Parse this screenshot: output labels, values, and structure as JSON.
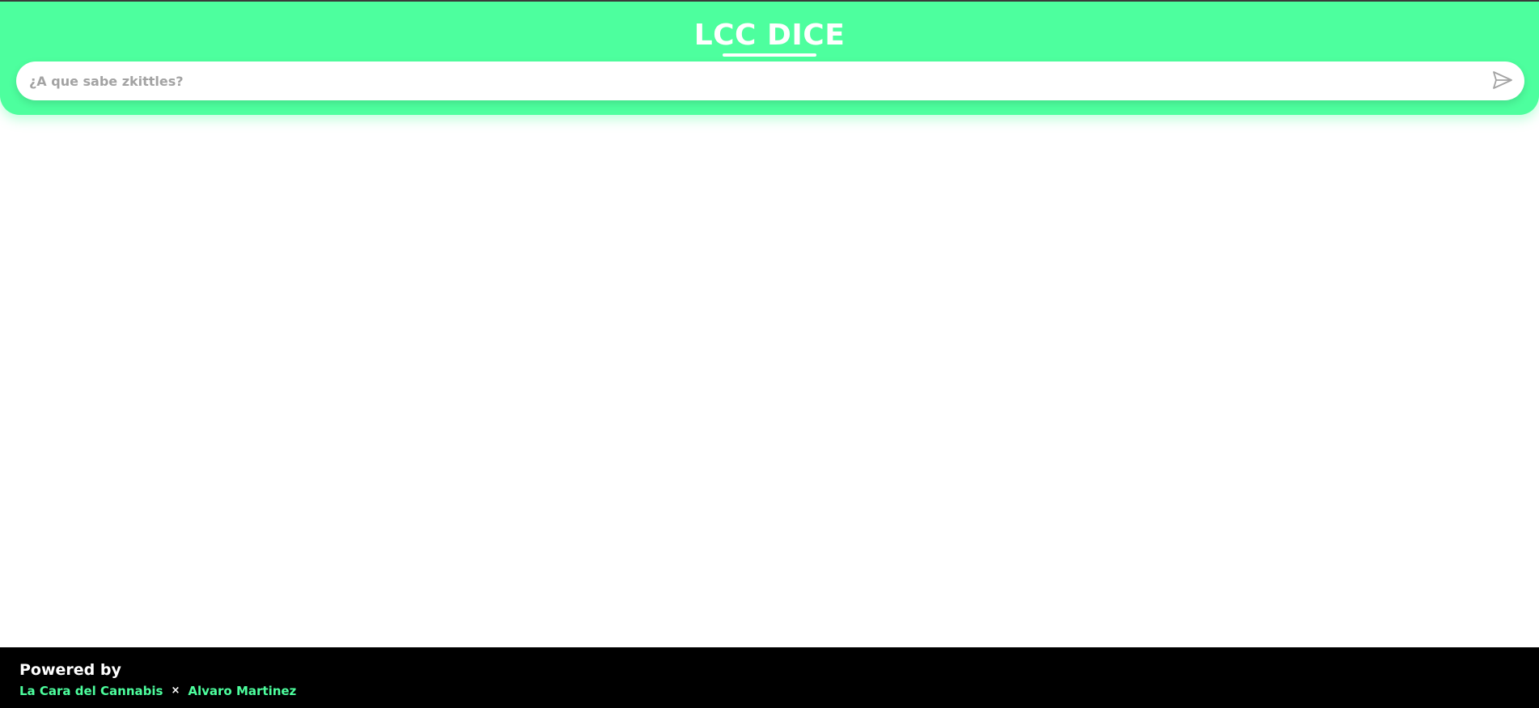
{
  "header": {
    "brand_title": "LCC DICE",
    "background_color": "#4dff9e"
  },
  "search": {
    "placeholder": "¿A que sabe zkittles?",
    "value": "",
    "send_icon": "send-icon"
  },
  "footer": {
    "powered_by": "Powered by",
    "links": [
      {
        "label": "La Cara del Cannabis"
      },
      {
        "label": "Alvaro Martinez"
      }
    ],
    "separator": "×",
    "link_color": "#4dff9e",
    "background_color": "#000000"
  }
}
